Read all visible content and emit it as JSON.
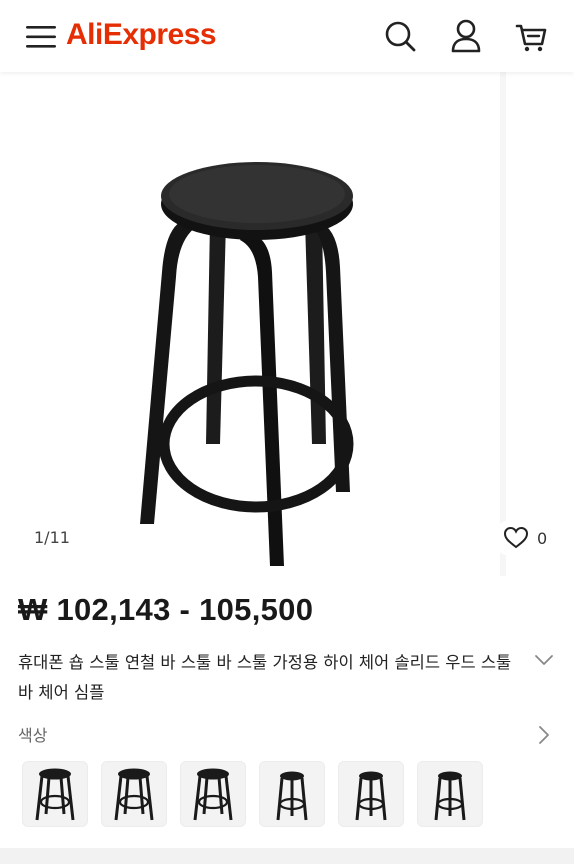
{
  "header": {
    "logo": "AliExpress",
    "icons": [
      "menu-icon",
      "search-icon",
      "account-icon",
      "cart-icon"
    ],
    "brand_color": "#e62e04"
  },
  "gallery": {
    "counter": "1/11",
    "wishlist_count": "0"
  },
  "product": {
    "price": "₩ 102,143 - 105,500",
    "title": "휴대폰 숍 스툴 연철 바 스툴 바 스툴 가정용 하이 체어 솔리드 우드 스툴 바 체어 심플"
  },
  "variants": {
    "label": "색상",
    "swatch_count": 6
  }
}
